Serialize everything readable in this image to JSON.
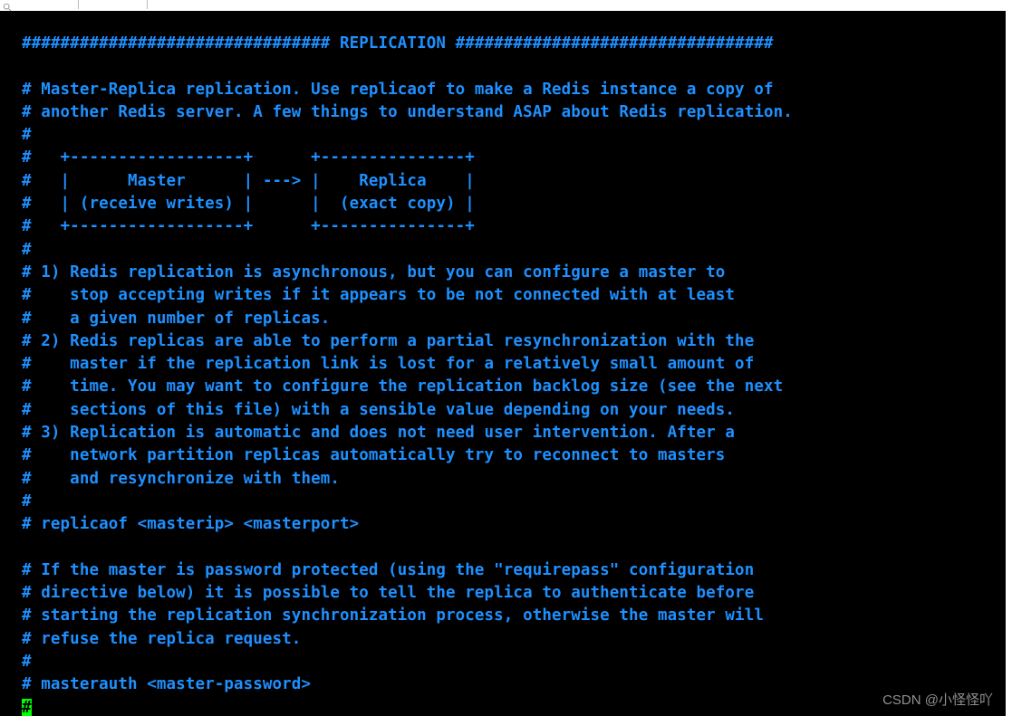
{
  "terminal": {
    "lines": [
      "################################ REPLICATION #################################",
      "",
      "# Master-Replica replication. Use replicaof to make a Redis instance a copy of",
      "# another Redis server. A few things to understand ASAP about Redis replication.",
      "#",
      "#   +------------------+      +---------------+",
      "#   |      Master      | ---> |    Replica    |",
      "#   | (receive writes) |      |  (exact copy) |",
      "#   +------------------+      +---------------+",
      "#",
      "# 1) Redis replication is asynchronous, but you can configure a master to",
      "#    stop accepting writes if it appears to be not connected with at least",
      "#    a given number of replicas.",
      "# 2) Redis replicas are able to perform a partial resynchronization with the",
      "#    master if the replication link is lost for a relatively small amount of",
      "#    time. You may want to configure the replication backlog size (see the next",
      "#    sections of this file) with a sensible value depending on your needs.",
      "# 3) Replication is automatic and does not need user intervention. After a",
      "#    network partition replicas automatically try to reconnect to masters",
      "#    and resynchronize with them.",
      "#",
      "# replicaof <masterip> <masterport>",
      "",
      "# If the master is password protected (using the \"requirepass\" configuration",
      "# directive below) it is possible to tell the replica to authenticate before",
      "# starting the replication synchronization process, otherwise the master will",
      "# refuse the replica request.",
      "#",
      "# masterauth <master-password>"
    ],
    "cursor_char": "#"
  },
  "watermark": "CSDN @小怪怪吖"
}
